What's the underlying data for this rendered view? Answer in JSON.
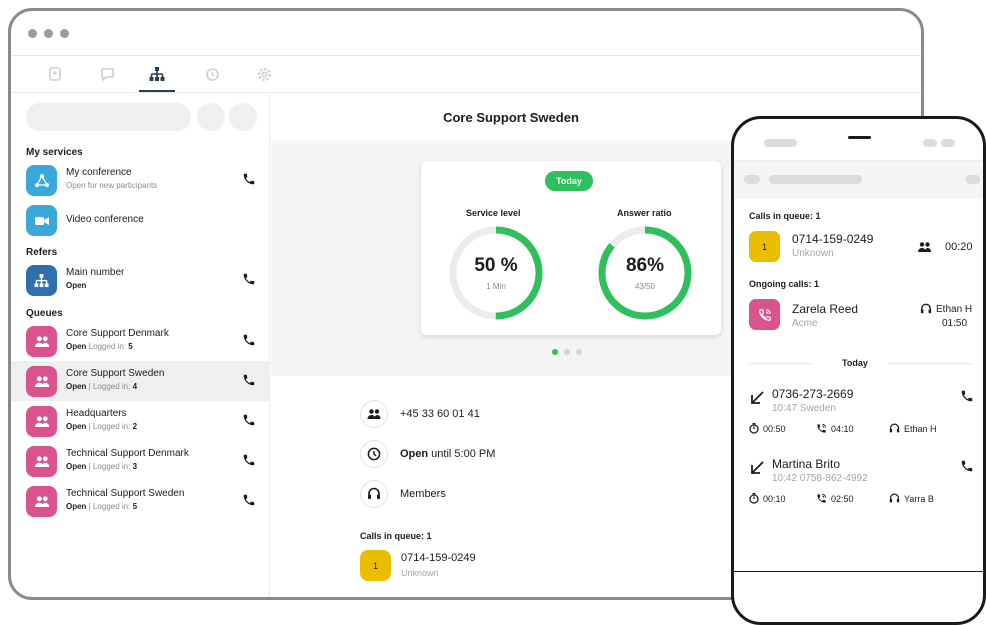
{
  "colors": {
    "green": "#2fbf5c",
    "blue": "#3ba8dc",
    "dark_blue": "#2f6fad",
    "pink": "#d9538f",
    "yellow": "#e9bd00"
  },
  "nav": {
    "tabs": [
      {
        "icon": "contacts-icon"
      },
      {
        "icon": "chat-icon"
      },
      {
        "icon": "org-chart-icon",
        "active": true
      },
      {
        "icon": "history-icon"
      },
      {
        "icon": "settings-icon"
      }
    ]
  },
  "sidebar": {
    "my_services_title": "My services",
    "my_services": [
      {
        "title": "My conference",
        "sub": "Open for new participants",
        "icon": "conference-icon"
      },
      {
        "title": "Video conference",
        "sub": "",
        "icon": "video-icon"
      }
    ],
    "refers_title": "Refers",
    "refers": [
      {
        "title": "Main number",
        "status": "Open",
        "icon": "org-chart-icon"
      }
    ],
    "queues_title": "Queues",
    "queues": [
      {
        "title": "Core Support Denmark",
        "status": "Open",
        "sep": " ",
        "logged": "Logged in:",
        "count": "5"
      },
      {
        "title": "Core Support Sweden",
        "status": "Open",
        "sep": " | ",
        "logged": "Logged in:",
        "count": "4",
        "selected": true
      },
      {
        "title": "Headquarters",
        "status": "Open",
        "sep": " | ",
        "logged": "Logged in:",
        "count": "2"
      },
      {
        "title": "Technical Support Denmark",
        "status": "Open",
        "sep": " | ",
        "logged": "Logged in:",
        "count": "3"
      },
      {
        "title": "Technical Support Sweden",
        "status": "Open",
        "sep": " | ",
        "logged": "Logged in:",
        "count": "5"
      }
    ]
  },
  "main": {
    "title": "Core Support Sweden",
    "badge": "Today",
    "service_level": {
      "label": "Service level",
      "value": "50 %",
      "sub": "1 Min",
      "fraction": 0.5
    },
    "answer_ratio": {
      "label": "Answer ratio",
      "value": "86%",
      "sub": "43/50",
      "fraction": 0.86
    },
    "pager": {
      "count": 3,
      "active": 0
    },
    "phone_number": "+45 33 60 01 41",
    "open_strong": "Open",
    "open_rest": " until 5:00 PM",
    "members": "Members",
    "calls_in_queue_title": "Calls in queue: 1",
    "queue_call": {
      "position": "1",
      "number": "0714-159-0249",
      "sub": "Unknown"
    }
  },
  "phone": {
    "calls_in_queue_title": "Calls in queue: 1",
    "queue_call": {
      "position": "1",
      "number": "0714-159-0249",
      "sub": "Unknown",
      "wait": "00:20"
    },
    "ongoing_title": "Ongoing calls: 1",
    "ongoing_call": {
      "name": "Zarela Reed",
      "sub": "Acme",
      "agent": "Ethan H",
      "duration": "01:50"
    },
    "today_label": "Today",
    "history": [
      {
        "title": "0736-273-2669",
        "sub": "10:47 Sweden",
        "wait": "00:50",
        "talk": "04:10",
        "agent": "Ethan H"
      },
      {
        "title": "Martina Brito",
        "sub": "10:42 0758-862-4992",
        "wait": "00:10",
        "talk": "02:50",
        "agent": "Yarra B"
      }
    ]
  }
}
